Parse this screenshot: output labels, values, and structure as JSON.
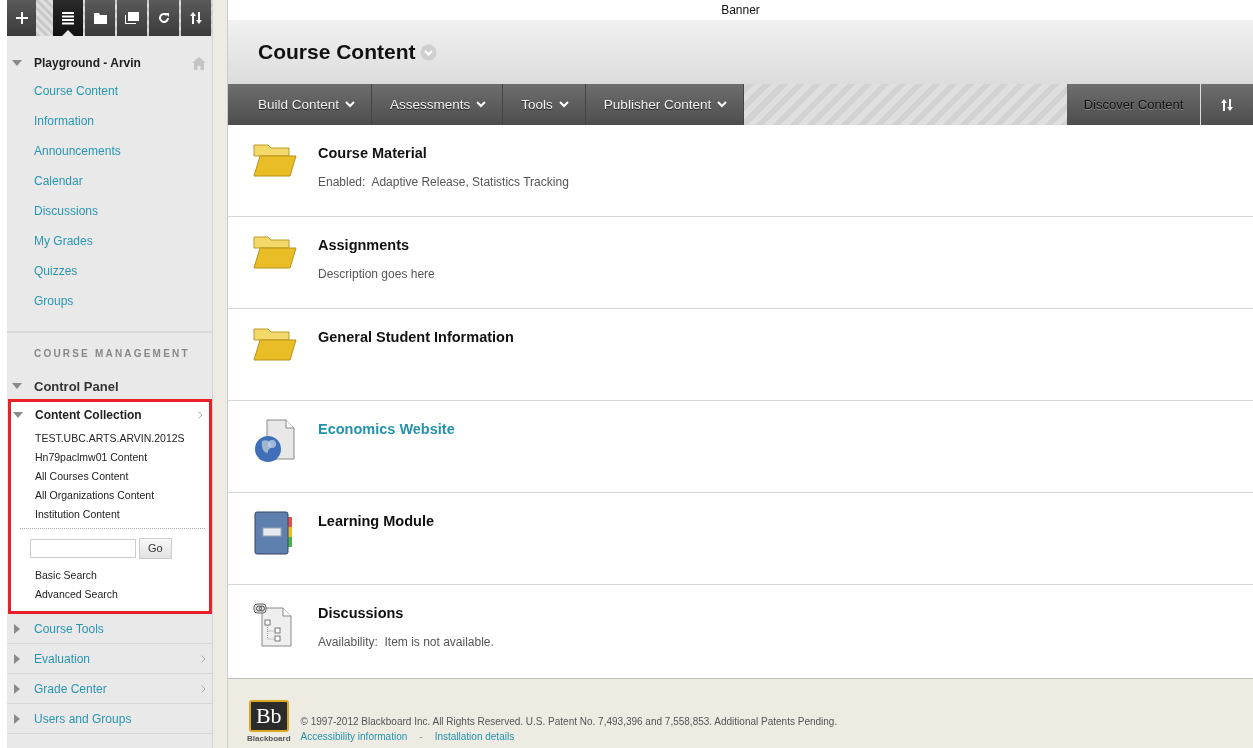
{
  "toolbar": [
    {
      "kind": "add",
      "selected": false
    },
    {
      "kind": "list",
      "selected": true
    },
    {
      "kind": "folder",
      "selected": false
    },
    {
      "kind": "windows",
      "selected": false
    },
    {
      "kind": "refresh",
      "selected": false
    },
    {
      "kind": "sort",
      "selected": false
    }
  ],
  "course_menu": {
    "title": "Playground - Arvin",
    "expanded": true,
    "items": [
      "Course Content",
      "Information",
      "Announcements",
      "Calendar",
      "Discussions",
      "My Grades",
      "Quizzes",
      "Groups"
    ]
  },
  "course_management": {
    "heading": "COURSE MANAGEMENT",
    "control_panel": {
      "label": "Control Panel",
      "expanded": true
    },
    "sections": [
      {
        "label": "Content Collection",
        "expanded": true,
        "highlighted": true,
        "has_submenu": true,
        "children": [
          "TEST.UBC.ARTS.ARVIN.2012S",
          "Hn79paclmw01 Content",
          "All Courses Content",
          "All Organizations Content",
          "Institution Content"
        ],
        "search_button": "Go",
        "links": [
          "Basic Search",
          "Advanced Search"
        ]
      },
      {
        "label": "Course Tools",
        "expanded": false,
        "highlighted": false,
        "has_submenu": false
      },
      {
        "label": "Evaluation",
        "expanded": false,
        "highlighted": false,
        "has_submenu": true
      },
      {
        "label": "Grade Center",
        "expanded": false,
        "highlighted": false,
        "has_submenu": true
      },
      {
        "label": "Users and Groups",
        "expanded": false,
        "highlighted": false,
        "has_submenu": false
      }
    ]
  },
  "banner": "Banner",
  "page_title": "Course Content",
  "action_bar": {
    "menus": [
      "Build Content",
      "Assessments",
      "Tools",
      "Publisher Content"
    ],
    "discover": "Discover Content"
  },
  "items": [
    {
      "kind": "folder",
      "title": "Course Material",
      "link": false,
      "details": "Enabled:  Adaptive Release, Statistics Tracking"
    },
    {
      "kind": "folder",
      "title": "Assignments",
      "link": false,
      "details": "Description goes here"
    },
    {
      "kind": "folder",
      "title": "General Student Information",
      "link": false
    },
    {
      "kind": "web",
      "title": "Economics Website",
      "link": true
    },
    {
      "kind": "module",
      "title": "Learning Module",
      "link": false
    },
    {
      "kind": "discussion",
      "title": "Discussions",
      "link": false,
      "details": "Availability:  Item is not available."
    }
  ],
  "footer": {
    "logo": "Bb",
    "brand": "Blackboard",
    "copyright": "© 1997-2012 Blackboard Inc. All Rights Reserved. U.S. Patent No. 7,493,396 and 7,558,853. Additional Patents Pending.",
    "links": [
      "Accessibility information",
      "Installation details"
    ],
    "separator": "-"
  }
}
